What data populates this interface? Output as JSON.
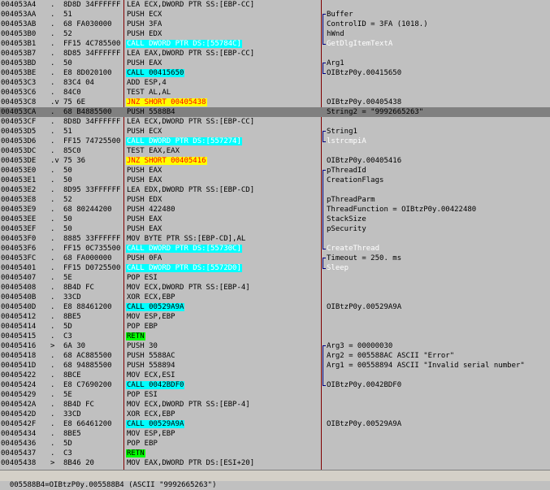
{
  "rows": [
    {
      "addr": "004053A4",
      "sym": ".",
      "hex": "8D8D 34FFFFFF",
      "instr": "LEA ECX,DWORD PTR SS:[EBP-CC]",
      "hl": "",
      "cmt": ""
    },
    {
      "addr": "004053AA",
      "sym": ".",
      "hex": "51",
      "instr": "PUSH ECX",
      "hl": "",
      "cmt": "Buffer"
    },
    {
      "addr": "004053AB",
      "sym": ".",
      "hex": "68 FA030000",
      "instr": "PUSH 3FA",
      "hl": "",
      "cmt": "ControlID = 3FA (1018.)"
    },
    {
      "addr": "004053B0",
      "sym": ".",
      "hex": "52",
      "instr": "PUSH EDX",
      "hl": "",
      "cmt": "hWnd"
    },
    {
      "addr": "004053B1",
      "sym": ".",
      "hex": "FF15 4C785500",
      "instr": "CALL DWORD PTR DS:[55784C]",
      "hl": "call",
      "cmt": "GetDlgItemTextA",
      "api": true
    },
    {
      "addr": "004053B7",
      "sym": ".",
      "hex": "8D85 34FFFFFF",
      "instr": "LEA EAX,DWORD PTR SS:[EBP-CC]",
      "hl": "",
      "cmt": ""
    },
    {
      "addr": "004053BD",
      "sym": ".",
      "hex": "50",
      "instr": "PUSH EAX",
      "hl": "",
      "cmt": "Arg1"
    },
    {
      "addr": "004053BE",
      "sym": ".",
      "hex": "E8 8D020100",
      "instr": "CALL 00415650",
      "hl": "call",
      "cmt": "OIBtzP0y.00415650"
    },
    {
      "addr": "004053C3",
      "sym": ".",
      "hex": "83C4 04",
      "instr": "ADD ESP,4",
      "hl": "",
      "cmt": ""
    },
    {
      "addr": "004053C6",
      "sym": ".",
      "hex": "84C0",
      "instr": "TEST AL,AL",
      "hl": "",
      "cmt": ""
    },
    {
      "addr": "004053C8",
      "sym": ".v",
      "hex": "75 6E",
      "instr": "JNZ SHORT 00405438",
      "hl": "jmp",
      "cmt": "OIBtzP0y.00405438"
    },
    {
      "addr": "004053CA",
      "sym": ".",
      "hex": "68 B4885500",
      "instr": "PUSH 5588B4",
      "hl": "",
      "cmt": "String2 = \"9992665263\"",
      "sel": true
    },
    {
      "addr": "004053CF",
      "sym": ".",
      "hex": "8D8D 34FFFFFF",
      "instr": "LEA ECX,DWORD PTR SS:[EBP-CC]",
      "hl": "",
      "cmt": ""
    },
    {
      "addr": "004053D5",
      "sym": ".",
      "hex": "51",
      "instr": "PUSH ECX",
      "hl": "",
      "cmt": "String1"
    },
    {
      "addr": "004053D6",
      "sym": ".",
      "hex": "FF15 74725500",
      "instr": "CALL DWORD PTR DS:[557274]",
      "hl": "call",
      "cmt": "lstrcmpiA",
      "api": true
    },
    {
      "addr": "004053DC",
      "sym": ".",
      "hex": "85C0",
      "instr": "TEST EAX,EAX",
      "hl": "",
      "cmt": ""
    },
    {
      "addr": "004053DE",
      "sym": ".v",
      "hex": "75 36",
      "instr": "JNZ SHORT 00405416",
      "hl": "jmp",
      "cmt": "OIBtzP0y.00405416"
    },
    {
      "addr": "004053E0",
      "sym": ".",
      "hex": "50",
      "instr": "PUSH EAX",
      "hl": "",
      "cmt": "pThreadId"
    },
    {
      "addr": "004053E1",
      "sym": ".",
      "hex": "50",
      "instr": "PUSH EAX",
      "hl": "",
      "cmt": "CreationFlags"
    },
    {
      "addr": "004053E2",
      "sym": ".",
      "hex": "8D95 33FFFFFF",
      "instr": "LEA EDX,DWORD PTR SS:[EBP-CD]",
      "hl": "",
      "cmt": ""
    },
    {
      "addr": "004053E8",
      "sym": ".",
      "hex": "52",
      "instr": "PUSH EDX",
      "hl": "",
      "cmt": "pThreadParm"
    },
    {
      "addr": "004053E9",
      "sym": ".",
      "hex": "68 80244200",
      "instr": "PUSH 422480",
      "hl": "",
      "cmt": "ThreadFunction = OIBtzP0y.00422480"
    },
    {
      "addr": "004053EE",
      "sym": ".",
      "hex": "50",
      "instr": "PUSH EAX",
      "hl": "",
      "cmt": "StackSize"
    },
    {
      "addr": "004053EF",
      "sym": ".",
      "hex": "50",
      "instr": "PUSH EAX",
      "hl": "",
      "cmt": "pSecurity"
    },
    {
      "addr": "004053F0",
      "sym": ".",
      "hex": "8885 33FFFFFF",
      "instr": "MOV BYTE PTR SS:[EBP-CD],AL",
      "hl": "",
      "cmt": ""
    },
    {
      "addr": "004053F6",
      "sym": ".",
      "hex": "FF15 0C735500",
      "instr": "CALL DWORD PTR DS:[55730C]",
      "hl": "call",
      "cmt": "CreateThread",
      "api": true
    },
    {
      "addr": "004053FC",
      "sym": ".",
      "hex": "68 FA000000",
      "instr": "PUSH 0FA",
      "hl": "",
      "cmt": "Timeout = 250. ms"
    },
    {
      "addr": "00405401",
      "sym": ".",
      "hex": "FF15 D0725500",
      "instr": "CALL DWORD PTR DS:[5572D0]",
      "hl": "call",
      "cmt": "Sleep",
      "api": true
    },
    {
      "addr": "00405407",
      "sym": ".",
      "hex": "5E",
      "instr": "POP ESI",
      "hl": "",
      "cmt": ""
    },
    {
      "addr": "00405408",
      "sym": ".",
      "hex": "8B4D FC",
      "instr": "MOV ECX,DWORD PTR SS:[EBP-4]",
      "hl": "",
      "cmt": ""
    },
    {
      "addr": "0040540B",
      "sym": ".",
      "hex": "33CD",
      "instr": "XOR ECX,EBP",
      "hl": "",
      "cmt": ""
    },
    {
      "addr": "0040540D",
      "sym": ".",
      "hex": "E8 88461200",
      "instr": "CALL 00529A9A",
      "hl": "call",
      "cmt": "OIBtzP0y.00529A9A"
    },
    {
      "addr": "00405412",
      "sym": ".",
      "hex": "8BE5",
      "instr": "MOV ESP,EBP",
      "hl": "",
      "cmt": ""
    },
    {
      "addr": "00405414",
      "sym": ".",
      "hex": "5D",
      "instr": "POP EBP",
      "hl": "",
      "cmt": ""
    },
    {
      "addr": "00405415",
      "sym": ".",
      "hex": "C3",
      "instr": "RETN",
      "hl": "ret",
      "cmt": ""
    },
    {
      "addr": "00405416",
      "sym": ">",
      "hex": "6A 30",
      "instr": "PUSH 30",
      "hl": "",
      "cmt": "Arg3 = 00000030"
    },
    {
      "addr": "00405418",
      "sym": ".",
      "hex": "68 AC885500",
      "instr": "PUSH 5588AC",
      "hl": "",
      "cmt": "Arg2 = 005588AC ASCII \"Error\""
    },
    {
      "addr": "0040541D",
      "sym": ".",
      "hex": "68 94885500",
      "instr": "PUSH 558894",
      "hl": "",
      "cmt": "Arg1 = 00558894 ASCII \"Invalid serial number\""
    },
    {
      "addr": "00405422",
      "sym": ".",
      "hex": "8BCE",
      "instr": "MOV ECX,ESI",
      "hl": "",
      "cmt": ""
    },
    {
      "addr": "00405424",
      "sym": ".",
      "hex": "E8 C7690200",
      "instr": "CALL 0042BDF0",
      "hl": "call",
      "cmt": "OIBtzP0y.0042BDF0"
    },
    {
      "addr": "00405429",
      "sym": ".",
      "hex": "5E",
      "instr": "POP ESI",
      "hl": "",
      "cmt": ""
    },
    {
      "addr": "0040542A",
      "sym": ".",
      "hex": "8B4D FC",
      "instr": "MOV ECX,DWORD PTR SS:[EBP-4]",
      "hl": "",
      "cmt": ""
    },
    {
      "addr": "0040542D",
      "sym": ".",
      "hex": "33CD",
      "instr": "XOR ECX,EBP",
      "hl": "",
      "cmt": ""
    },
    {
      "addr": "0040542F",
      "sym": ".",
      "hex": "E8 66461200",
      "instr": "CALL 00529A9A",
      "hl": "call",
      "cmt": "OIBtzP0y.00529A9A"
    },
    {
      "addr": "00405434",
      "sym": ".",
      "hex": "8BE5",
      "instr": "MOV ESP,EBP",
      "hl": "",
      "cmt": ""
    },
    {
      "addr": "00405436",
      "sym": ".",
      "hex": "5D",
      "instr": "POP EBP",
      "hl": "",
      "cmt": ""
    },
    {
      "addr": "00405437",
      "sym": ".",
      "hex": "C3",
      "instr": "RETN",
      "hl": "ret",
      "cmt": ""
    },
    {
      "addr": "00405438",
      "sym": ">",
      "hex": "8B46 20",
      "instr": "MOV EAX,DWORD PTR DS:[ESI+20]",
      "hl": "",
      "cmt": ""
    }
  ],
  "status": {
    "text": "005588B4=OIBtzP0y.005588B4 (ASCII \"9992665263\")"
  },
  "colors": {
    "background": "#c0c0c0",
    "selected_row": "#808080",
    "call_highlight": "#00ffff",
    "jump_highlight": "#ffff00",
    "jump_text": "#ff0000",
    "ret_highlight": "#00ff00",
    "api_comment": "#ffffff",
    "column_separator": "#800000"
  }
}
